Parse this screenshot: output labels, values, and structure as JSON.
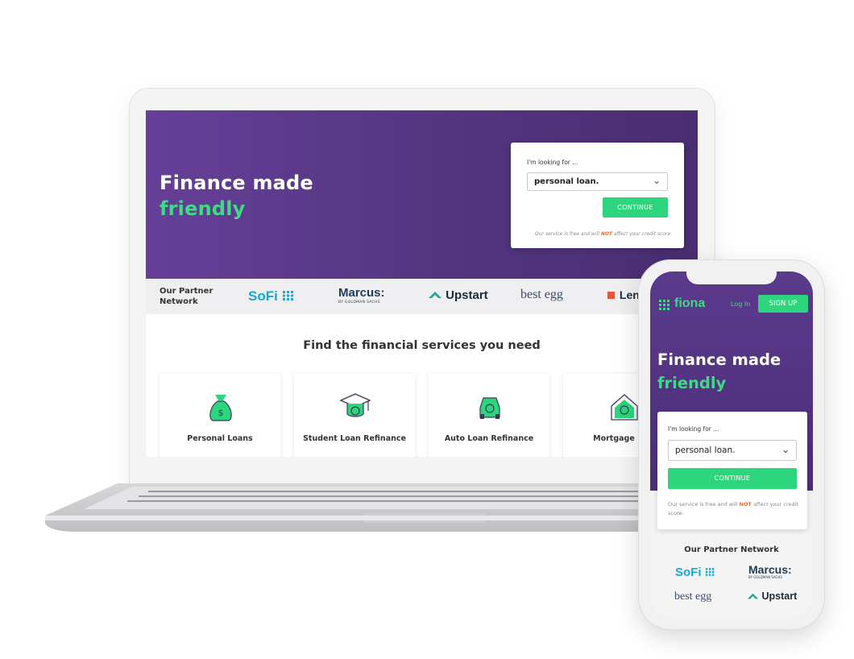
{
  "desktop": {
    "hero": {
      "title_line1": "Finance made",
      "title_line2": "friendly",
      "accent_color": "#3ddc84",
      "background_color": "#5b3a8c"
    },
    "form": {
      "label": "I'm looking for ...",
      "selected": "personal loan.",
      "continue_label": "CONTINUE",
      "disclaimer_prefix": "Our service is free and will",
      "disclaimer_emphasis": "NOT",
      "disclaimer_suffix": "affect your credit score."
    },
    "partners": {
      "label": "Our Partner Network",
      "logos": [
        "SoFi",
        "Marcus:",
        "Upstart",
        "best egg",
        "Lend"
      ],
      "marcus_sub": "BY GOLDMAN SACHS"
    },
    "services": {
      "title": "Find the financial services you need",
      "items": [
        {
          "label": "Personal Loans",
          "icon": "money-bag-icon"
        },
        {
          "label": "Student Loan Refinance",
          "icon": "graduation-cap-icon"
        },
        {
          "label": "Auto Loan Refinance",
          "icon": "car-icon"
        },
        {
          "label": "Mortgage Refi",
          "icon": "house-icon"
        }
      ]
    }
  },
  "mobile": {
    "header": {
      "logo": "fiona",
      "login_label": "Log In",
      "signup_label": "SIGN UP"
    },
    "hero": {
      "title_line1": "Finance made",
      "title_line2": "friendly"
    },
    "form": {
      "label": "I'm looking for ...",
      "selected": "personal loan.",
      "continue_label": "CONTINUE",
      "disclaimer_prefix": "Our service is free and will",
      "disclaimer_emphasis": "NOT",
      "disclaimer_suffix": "affect your credit score."
    },
    "partners": {
      "title": "Our Partner Network",
      "logos": [
        "SoFi",
        "Marcus:",
        "best egg",
        "Upstart"
      ],
      "marcus_sub": "BY GOLDMAN SACHS"
    }
  }
}
